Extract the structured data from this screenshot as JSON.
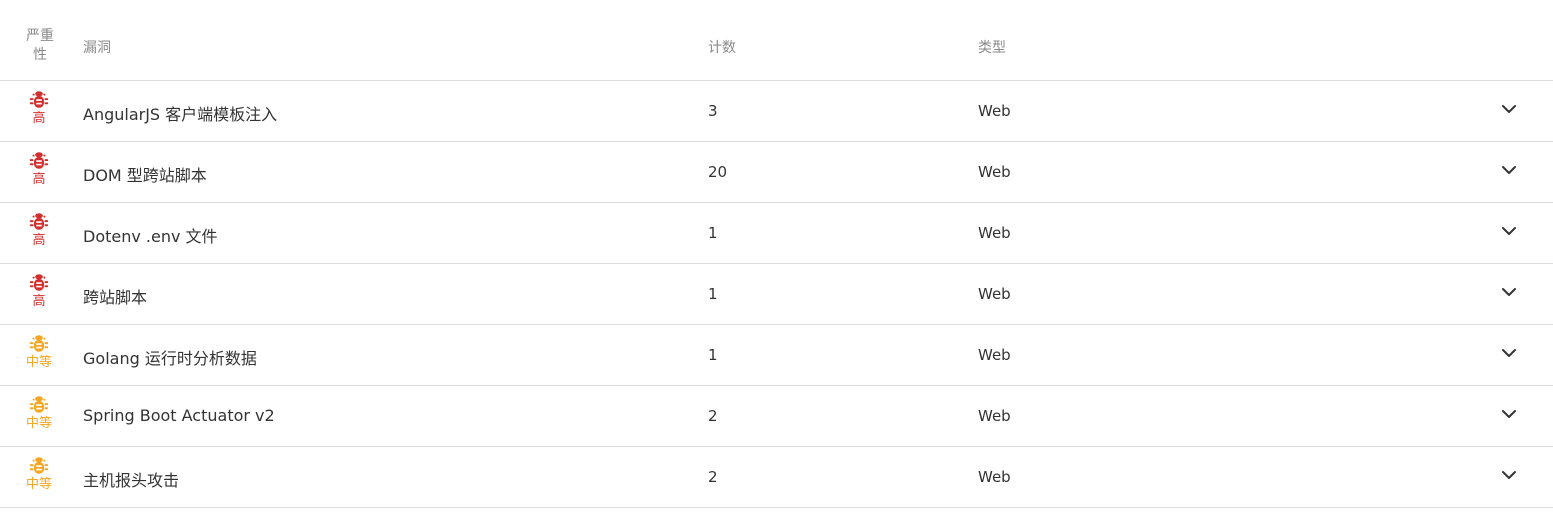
{
  "header": {
    "severity": "严重性",
    "vulnerability": "漏洞",
    "count": "计数",
    "type": "类型"
  },
  "colors": {
    "high": "#d32f2f",
    "medium": "#f5a623"
  },
  "rows": [
    {
      "severity": "高",
      "level": "high",
      "icon": "bug-icon",
      "vulnerability": "AngularJS 客户端模板注入",
      "count": "3",
      "type": "Web"
    },
    {
      "severity": "高",
      "level": "high",
      "icon": "bug-icon",
      "vulnerability": "DOM 型跨站脚本",
      "count": "20",
      "type": "Web"
    },
    {
      "severity": "高",
      "level": "high",
      "icon": "bug-icon",
      "vulnerability": "Dotenv .env 文件",
      "count": "1",
      "type": "Web"
    },
    {
      "severity": "高",
      "level": "high",
      "icon": "bug-icon",
      "vulnerability": "跨站脚本",
      "count": "1",
      "type": "Web"
    },
    {
      "severity": "中等",
      "level": "medium",
      "icon": "bug-icon",
      "vulnerability": "Golang 运行时分析数据",
      "count": "1",
      "type": "Web"
    },
    {
      "severity": "中等",
      "level": "medium",
      "icon": "bug-icon",
      "vulnerability": "Spring Boot Actuator v2",
      "count": "2",
      "type": "Web"
    },
    {
      "severity": "中等",
      "level": "medium",
      "icon": "bug-icon",
      "vulnerability": "主机报头攻击",
      "count": "2",
      "type": "Web"
    }
  ]
}
